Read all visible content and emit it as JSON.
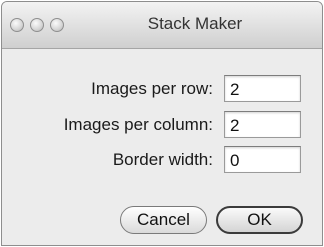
{
  "window": {
    "title": "Stack Maker"
  },
  "fields": [
    {
      "label": "Images per row:",
      "value": "2"
    },
    {
      "label": "Images per column:",
      "value": "2"
    },
    {
      "label": "Border width:",
      "value": "0"
    }
  ],
  "buttons": {
    "cancel_label": "Cancel",
    "ok_label": "OK"
  }
}
